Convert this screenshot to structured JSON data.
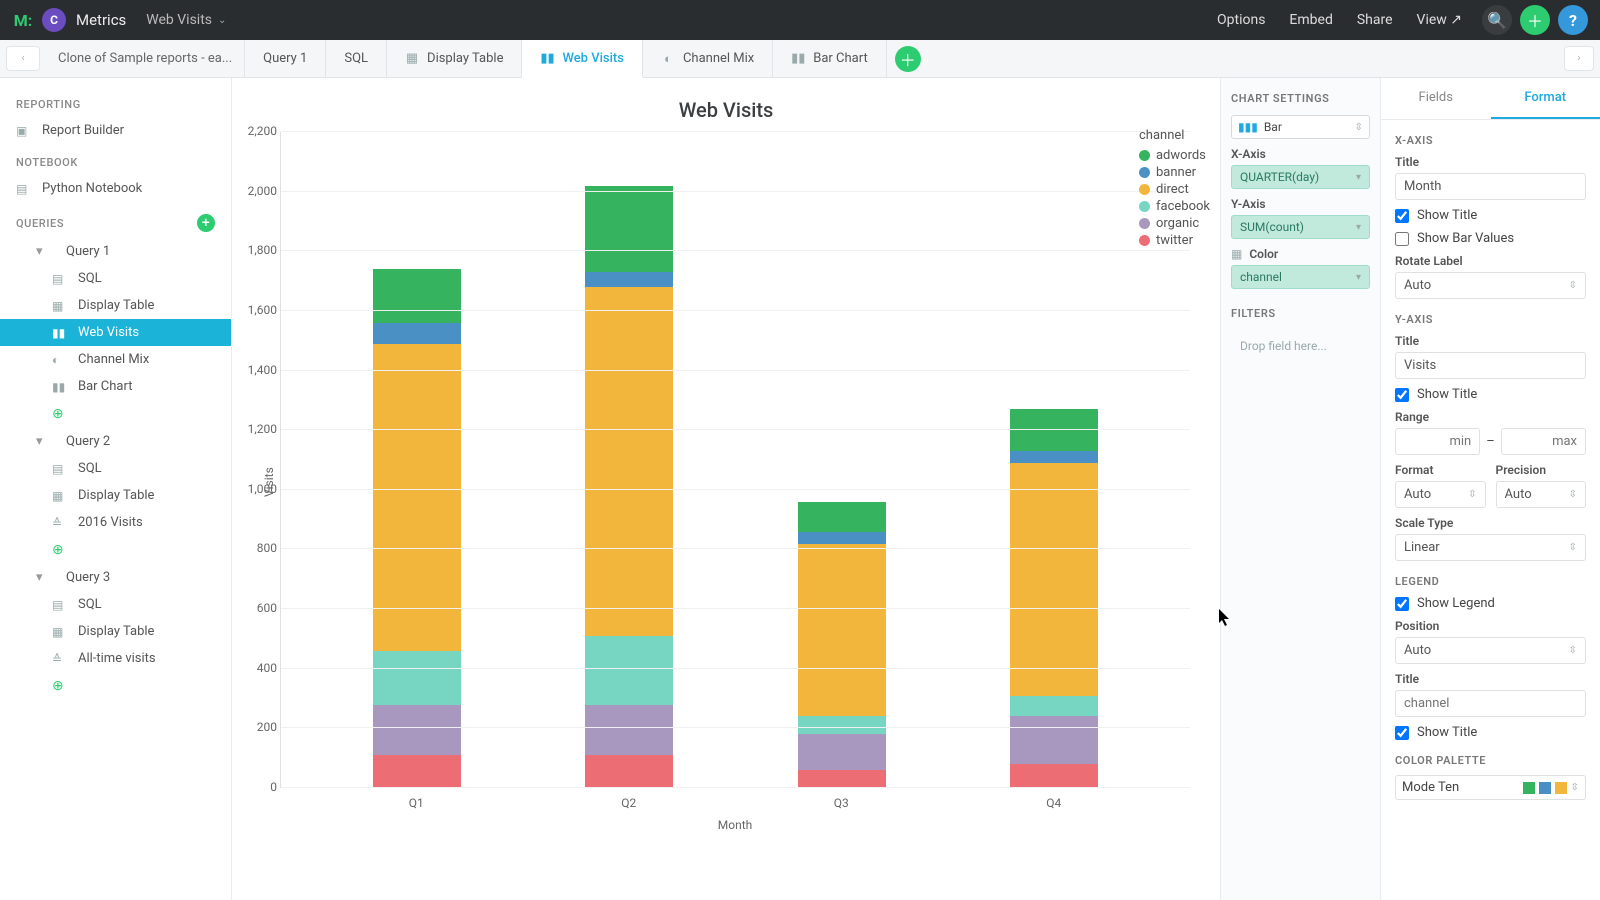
{
  "topbar": {
    "workspace": "Metrics",
    "report_name": "Web Visits",
    "actions": {
      "options": "Options",
      "embed": "Embed",
      "share": "Share",
      "view": "View"
    },
    "avatar_initial": "?"
  },
  "breadcrumb": {
    "title": "Clone of Sample reports - ea..."
  },
  "tabs": [
    {
      "label": "Query 1",
      "icon": ""
    },
    {
      "label": "SQL",
      "icon": ""
    },
    {
      "label": "Display Table",
      "icon": "table"
    },
    {
      "label": "Web Visits",
      "icon": "bars",
      "active": true
    },
    {
      "label": "Channel Mix",
      "icon": "pie"
    },
    {
      "label": "Bar Chart",
      "icon": "bars"
    }
  ],
  "sidebar": {
    "reporting_header": "REPORTING",
    "report_builder": "Report Builder",
    "notebook_header": "NOTEBOOK",
    "python_notebook": "Python Notebook",
    "queries_header": "QUERIES",
    "queries": [
      {
        "name": "Query 1",
        "items": [
          {
            "label": "SQL",
            "icon": "sql"
          },
          {
            "label": "Display Table",
            "icon": "table"
          },
          {
            "label": "Web Visits",
            "icon": "bars",
            "active": true
          },
          {
            "label": "Channel Mix",
            "icon": "pie"
          },
          {
            "label": "Bar Chart",
            "icon": "bars"
          }
        ]
      },
      {
        "name": "Query 2",
        "items": [
          {
            "label": "SQL",
            "icon": "sql"
          },
          {
            "label": "Display Table",
            "icon": "table"
          },
          {
            "label": "2016 Visits",
            "icon": "area",
            "prefix": "≙"
          }
        ]
      },
      {
        "name": "Query 3",
        "items": [
          {
            "label": "SQL",
            "icon": "sql"
          },
          {
            "label": "Display Table",
            "icon": "table"
          },
          {
            "label": "All-time visits",
            "icon": "area",
            "prefix": "≙"
          }
        ]
      }
    ]
  },
  "chart_settings": {
    "header": "CHART SETTINGS",
    "type_label": "Bar",
    "x_axis_label": "X-Axis",
    "x_axis_value": "QUARTER(day)",
    "y_axis_label": "Y-Axis",
    "y_axis_value": "SUM(count)",
    "color_label": "Color",
    "color_value": "channel",
    "filters_header": "FILTERS",
    "filters_placeholder": "Drop field here..."
  },
  "format_panel": {
    "tabs": {
      "fields": "Fields",
      "format": "Format"
    },
    "x_section": "X-AXIS",
    "x_title_label": "Title",
    "x_title_value": "Month",
    "show_title": "Show Title",
    "show_bar_values": "Show Bar Values",
    "rotate_label": "Rotate Label",
    "rotate_value": "Auto",
    "y_section": "Y-AXIS",
    "y_title_label": "Title",
    "y_title_value": "Visits",
    "range_label": "Range",
    "range_min_ph": "min",
    "range_max_ph": "max",
    "format_label": "Format",
    "format_value": "Auto",
    "precision_label": "Precision",
    "precision_value": "Auto",
    "scale_label": "Scale Type",
    "scale_value": "Linear",
    "legend_section": "LEGEND",
    "show_legend": "Show Legend",
    "position_label": "Position",
    "position_value": "Auto",
    "legend_title_label": "Title",
    "legend_title_ph": "channel",
    "palette_section": "COLOR PALETTE",
    "palette_value": "Mode Ten"
  },
  "chart_data": {
    "type": "bar",
    "title": "Web Visits",
    "xlabel": "Month",
    "ylabel": "Visits",
    "ylim": [
      0,
      2200
    ],
    "y_ticks": [
      0,
      200,
      400,
      600,
      800,
      1000,
      1200,
      1400,
      1600,
      1800,
      2000,
      2200
    ],
    "categories": [
      "Q1",
      "Q2",
      "Q3",
      "Q4"
    ],
    "legend_title": "channel",
    "series": [
      {
        "name": "adwords",
        "color": "#35b35f",
        "values": [
          180,
          290,
          100,
          140
        ]
      },
      {
        "name": "banner",
        "color": "#4b90c5",
        "values": [
          70,
          50,
          40,
          40
        ]
      },
      {
        "name": "direct",
        "color": "#f2b63c",
        "values": [
          1030,
          1170,
          580,
          780
        ]
      },
      {
        "name": "facebook",
        "color": "#77d6c1",
        "values": [
          180,
          230,
          60,
          70
        ]
      },
      {
        "name": "organic",
        "color": "#a897bf",
        "values": [
          170,
          170,
          120,
          160
        ]
      },
      {
        "name": "twitter",
        "color": "#ec6d74",
        "values": [
          110,
          110,
          60,
          80
        ]
      }
    ]
  }
}
